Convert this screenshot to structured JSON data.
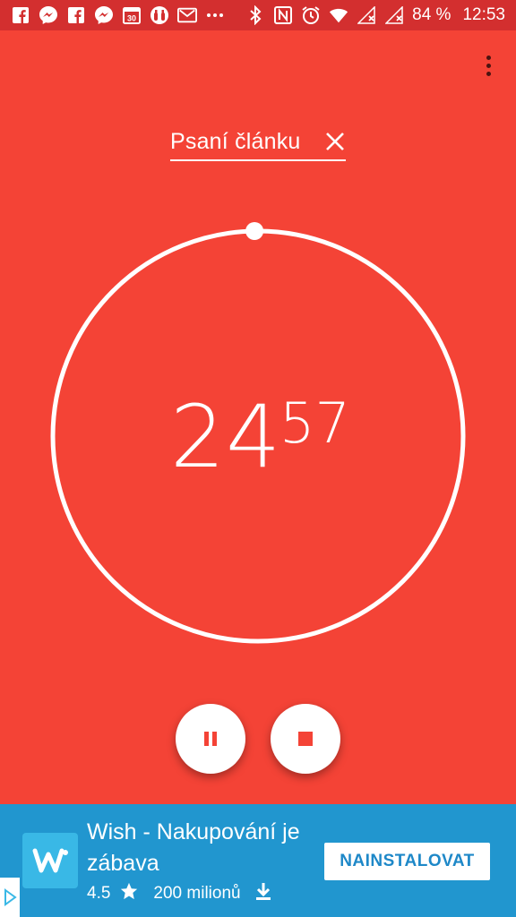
{
  "status_bar": {
    "battery": "84 %",
    "time": "12:53",
    "left_icons": [
      "facebook-icon",
      "messenger-icon",
      "facebook-icon",
      "messenger-icon",
      "calendar-icon",
      "binoculars-icon",
      "gmail-icon",
      "more-icon"
    ],
    "calendar_day": "30",
    "right_icons": [
      "bluetooth-icon",
      "nfc-icon",
      "alarm-icon",
      "wifi-icon",
      "signal-icon",
      "signal-icon"
    ]
  },
  "timer": {
    "label": "Psaní článku",
    "minutes": "24",
    "seconds": "57",
    "progress_elapsed": 0.0,
    "ring_color": "#FFFFFF"
  },
  "colors": {
    "background": "#F44336",
    "status_bar": "#D32F2F",
    "ad_background": "#2196CF"
  },
  "ad": {
    "title": "Wish - Nakupování je zábava",
    "rating": "4.5",
    "downloads": "200 milionů",
    "button": "NAINSTALOVAT"
  }
}
